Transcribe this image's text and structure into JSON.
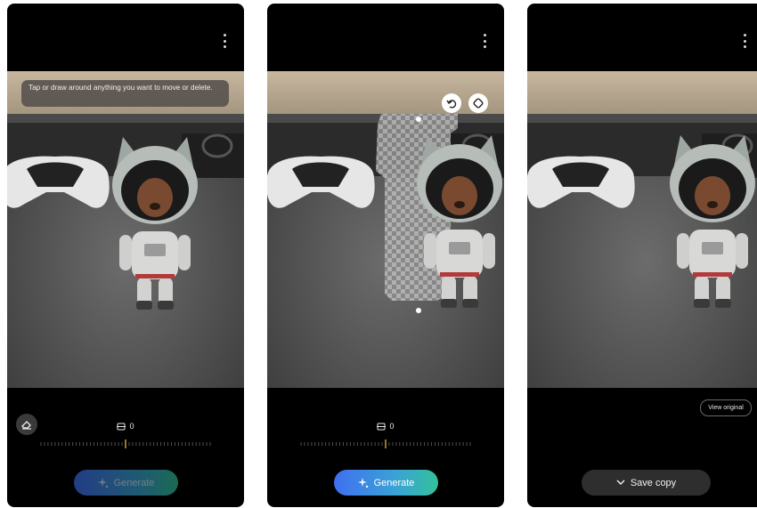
{
  "screens": [
    {
      "hint": "Tap or draw around anything you want to move or delete.",
      "slider_value": "0",
      "generate_label": "Generate"
    },
    {
      "slider_value": "0",
      "generate_label": "Generate"
    },
    {
      "view_original_label": "View original",
      "save_copy_label": "Save copy"
    }
  ],
  "colors": {
    "background": "#000000",
    "generate_gradient": [
      "#3f6ff2",
      "#3aa3d4",
      "#33c29a"
    ],
    "save_button": "#2e2e2e",
    "slider_marker": "#e0a93a"
  },
  "icons": [
    "more-options-icon",
    "eraser-icon",
    "undo-icon",
    "lasso-icon",
    "angle-icon",
    "sparkle-icon",
    "chevron-down-icon"
  ]
}
